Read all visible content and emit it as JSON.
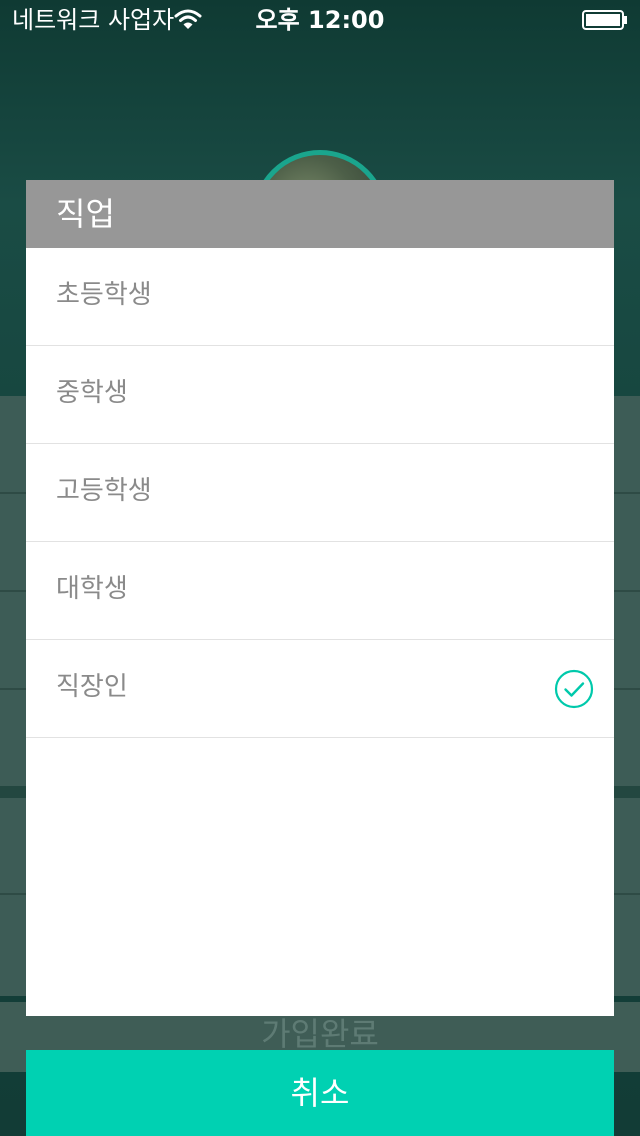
{
  "status_bar": {
    "carrier": "네트워크 사업자",
    "time": "오후 12:00"
  },
  "background": {
    "signup_button_label": "가입완료"
  },
  "dialog": {
    "title": "직업",
    "options": [
      {
        "label": "초등학생",
        "selected": false
      },
      {
        "label": "중학생",
        "selected": false
      },
      {
        "label": "고등학생",
        "selected": false
      },
      {
        "label": "대학생",
        "selected": false
      },
      {
        "label": "직장인",
        "selected": true
      }
    ],
    "cancel_label": "취소"
  },
  "colors": {
    "accent": "#00d1b2",
    "header": "#979797"
  },
  "icons": [
    "wifi-icon",
    "battery-icon",
    "checkmark-circle-icon"
  ]
}
